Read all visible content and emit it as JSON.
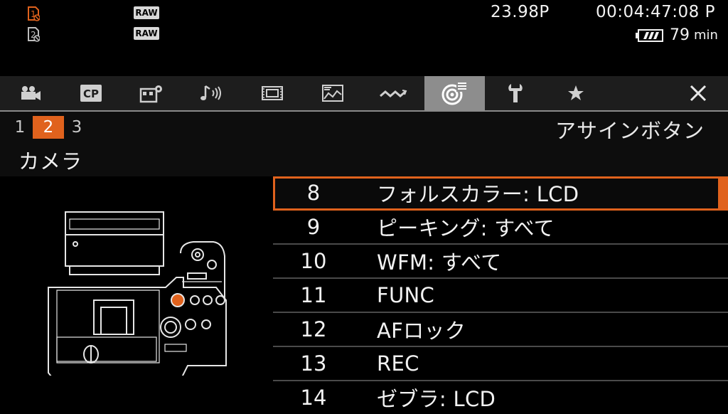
{
  "status": {
    "card1": "1",
    "card2": "2",
    "raw1": "RAW",
    "raw2": "RAW",
    "frame_rate": "23.98P",
    "timecode": "00:04:47:08 P",
    "battery_time": "79",
    "battery_unit": "min",
    "accent": "#e0621d"
  },
  "tabs": [
    {
      "name": "camera",
      "icon": "movie-camera-icon"
    },
    {
      "name": "custom-picture",
      "icon": "cp-icon",
      "label": "CP"
    },
    {
      "name": "recording",
      "icon": "rec-settings-icon"
    },
    {
      "name": "audio",
      "icon": "audio-icon"
    },
    {
      "name": "playback",
      "icon": "film-strip-icon"
    },
    {
      "name": "display",
      "icon": "monitor-icon"
    },
    {
      "name": "network",
      "icon": "wireless-icon"
    },
    {
      "name": "assign",
      "icon": "assign-button-icon",
      "active": true
    },
    {
      "name": "system",
      "icon": "wrench-icon"
    },
    {
      "name": "my-menu",
      "icon": "star-icon"
    },
    {
      "name": "close",
      "icon": "close-icon"
    }
  ],
  "header": {
    "pages": [
      "1",
      "2",
      "3"
    ],
    "current_page": "2",
    "menu_title": "アサインボタン",
    "category": "カメラ"
  },
  "items": [
    {
      "num": "8",
      "label": "フォルスカラー: LCD",
      "selected": true
    },
    {
      "num": "9",
      "label": "ピーキング: すべて"
    },
    {
      "num": "10",
      "label": "WFM: すべて"
    },
    {
      "num": "11",
      "label": "FUNC"
    },
    {
      "num": "12",
      "label": "AFロック"
    },
    {
      "num": "13",
      "label": "REC"
    },
    {
      "num": "14",
      "label": "ゼブラ: LCD"
    }
  ]
}
